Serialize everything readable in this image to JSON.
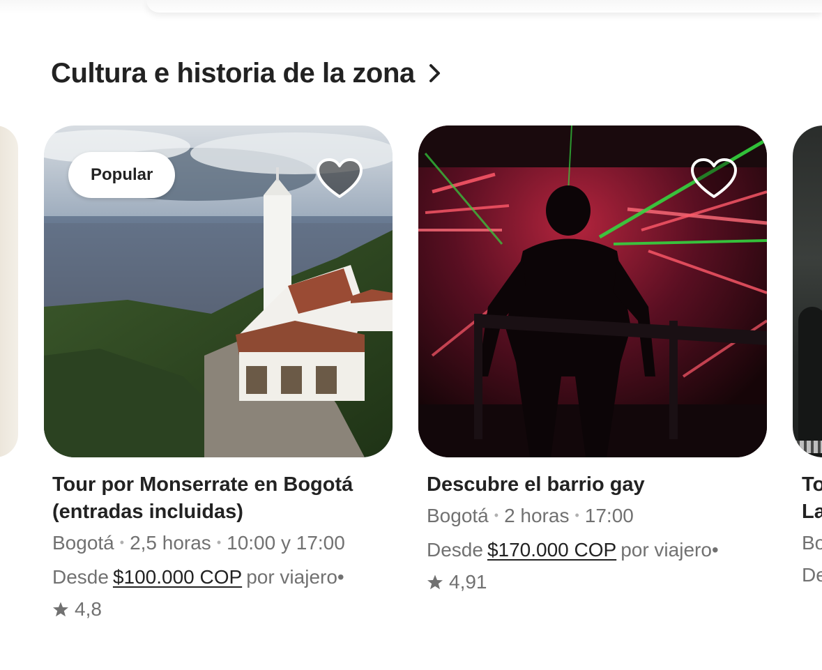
{
  "section": {
    "title": "Cultura e historia de la zona",
    "chevron_icon": "chevron-right-icon"
  },
  "cards": [
    {
      "badge": "Popular",
      "heart_icon": "heart-icon",
      "title_line1": "Tour por Monserrate en Bogotá",
      "title_line2": "(entradas incluidas)",
      "location": "Bogotá",
      "duration": "2,5 horas",
      "times": "10:00 y 17:00",
      "price_prefix": "Desde",
      "price": "$100.000 COP",
      "price_suffix": "por viajero",
      "rating": "4,8"
    },
    {
      "heart_icon": "heart-icon",
      "title_line1": "Descubre el barrio gay",
      "location": "Bogotá",
      "duration": "2 horas",
      "times": "17:00",
      "price_prefix": "Desde",
      "price": "$170.000 COP",
      "price_suffix": "por viajero",
      "rating": "4,91"
    }
  ],
  "partial_card": {
    "title_line1": "To",
    "title_line2": "La",
    "meta": "Bo",
    "price": "De"
  },
  "colors": {
    "text_primary": "#222222",
    "text_secondary": "#717171",
    "background": "#ffffff"
  }
}
